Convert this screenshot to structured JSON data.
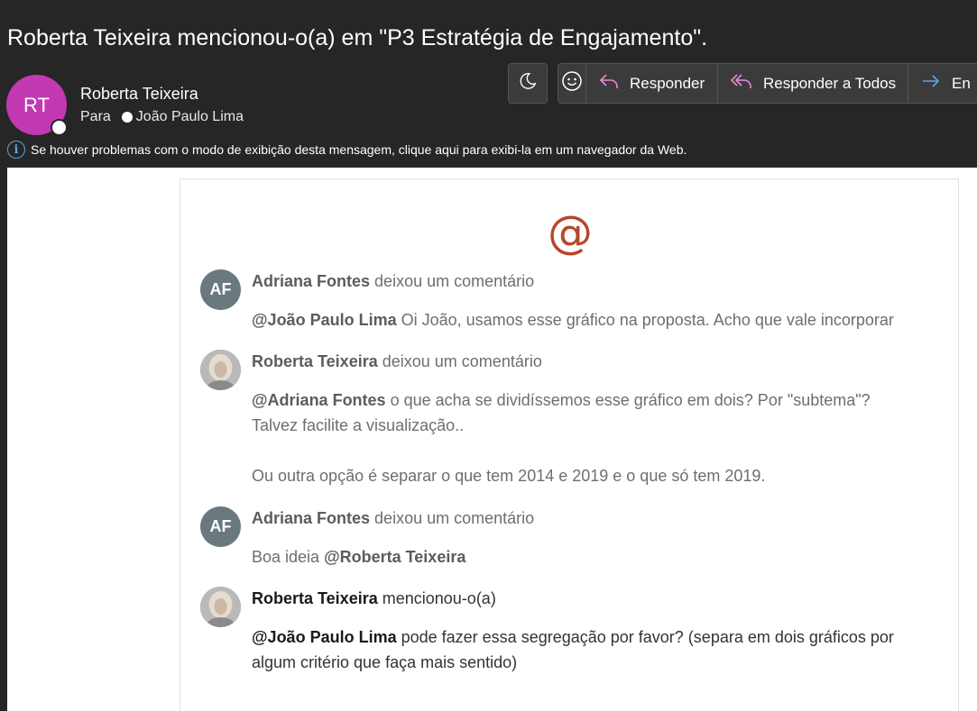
{
  "header": {
    "subject": "Roberta Teixeira mencionou-o(a) em \"P3 Estratégia de Engajamento\".",
    "sender_initials": "RT",
    "sender_name": "Roberta Teixeira",
    "to_label": "Para",
    "recipient": "João Paulo Lima",
    "info_text": "Se houver problemas com o modo de exibição desta mensagem, clique aqui para exibi-la em um navegador da Web."
  },
  "toolbar": {
    "reply_label": "Responder",
    "reply_all_label": "Responder a Todos",
    "forward_label": "En"
  },
  "email_body": {
    "mention_symbol": "@",
    "comments": [
      {
        "initials": "AF",
        "author": "Adriana Fontes",
        "action": "deixou um comentário",
        "mention": "@João Paulo Lima",
        "text": "Oi João, usamos esse gráfico na proposta. Acho que vale incorporar"
      },
      {
        "author": "Roberta Teixeira",
        "action": "deixou um comentário",
        "mention": "@Adriana Fontes",
        "text_line1": "o que acha se dividíssemos esse gráfico em dois? Por \"subtema\"?",
        "text_line2": "Talvez facilite a visualização..",
        "text_line3": "Ou outra opção é separar o que tem 2014 e 2019 e o que só tem 2019."
      },
      {
        "initials": "AF",
        "author": "Adriana Fontes",
        "action": "deixou um comentário",
        "text": "Boa ideia",
        "mention": "@Roberta Teixeira"
      },
      {
        "author": "Roberta Teixeira",
        "action": "mencionou-o(a)",
        "mention": "@João Paulo Lima",
        "text_line1": "pode fazer essa segregação por favor? (separa em dois gráficos por",
        "text_line2": "algum critério que faça mais sentido)"
      }
    ]
  },
  "colors": {
    "background": "#262626",
    "avatar_rt": "#c239b3",
    "avatar_af": "#69797e",
    "mention_accent": "#b7472a",
    "reply_icon": "#e58ad7",
    "forward_icon": "#5ca3e6"
  },
  "icons": [
    "moon-icon",
    "emoji-icon",
    "reply-icon",
    "reply-all-icon",
    "forward-icon",
    "info-icon"
  ]
}
